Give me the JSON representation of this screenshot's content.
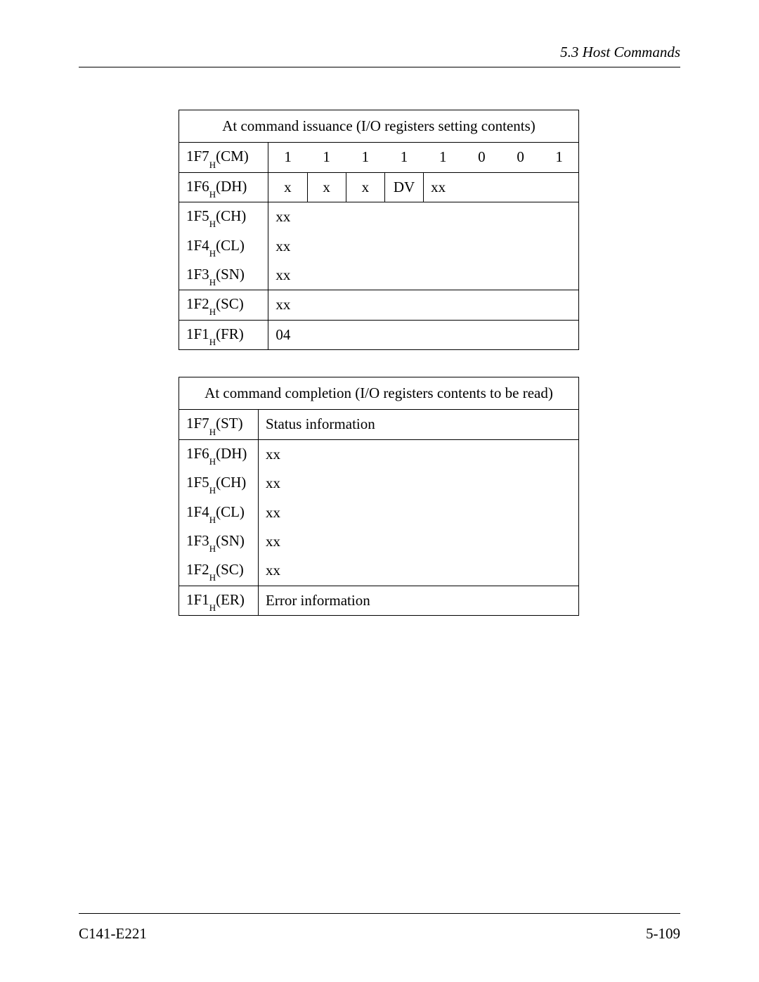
{
  "header": {
    "section": "5.3  Host Commands"
  },
  "table1": {
    "title": "At command issuance (I/O registers setting contents)",
    "rows": [
      {
        "reg": {
          "addr": "1F7",
          "sub": "H",
          "name": "(CM)"
        },
        "bits": [
          "1",
          "1",
          "1",
          "1",
          "1",
          "0",
          "0",
          "1"
        ],
        "bit_borders": [
          false,
          false,
          false,
          false,
          false,
          false,
          false,
          false
        ],
        "type": "bits"
      },
      {
        "reg": {
          "addr": "1F6",
          "sub": "H",
          "name": "(DH)"
        },
        "bits": [
          "x",
          "x",
          "x",
          "DV",
          "xx"
        ],
        "bit_borders": [
          true,
          true,
          true,
          true,
          false
        ],
        "wide_last": true,
        "type": "bits-dh",
        "row_border_top": true
      },
      {
        "reg": {
          "addr": "1F5",
          "sub": "H",
          "name": "(CH)"
        },
        "value": "xx",
        "type": "group-first"
      },
      {
        "reg": {
          "addr": "1F4",
          "sub": "H",
          "name": "(CL)"
        },
        "value": "xx",
        "type": "group"
      },
      {
        "reg": {
          "addr": "1F3",
          "sub": "H",
          "name": "(SN)"
        },
        "value": "xx",
        "type": "group"
      },
      {
        "reg": {
          "addr": "1F2",
          "sub": "H",
          "name": "(SC)"
        },
        "value": "xx",
        "type": "single"
      },
      {
        "reg": {
          "addr": "1F1",
          "sub": "H",
          "name": "(FR)"
        },
        "value": "04",
        "type": "single"
      }
    ]
  },
  "table2": {
    "title": "At command completion (I/O registers contents to be read)",
    "rows": [
      {
        "reg": {
          "addr": "1F7",
          "sub": "H",
          "name": "(ST)"
        },
        "value": "Status information",
        "type": "single-first"
      },
      {
        "reg": {
          "addr": "1F6",
          "sub": "H",
          "name": "(DH)"
        },
        "value": "xx",
        "type": "group-first"
      },
      {
        "reg": {
          "addr": "1F5",
          "sub": "H",
          "name": "(CH)"
        },
        "value": "xx",
        "type": "group"
      },
      {
        "reg": {
          "addr": "1F4",
          "sub": "H",
          "name": "(CL)"
        },
        "value": "xx",
        "type": "group"
      },
      {
        "reg": {
          "addr": "1F3",
          "sub": "H",
          "name": "(SN)"
        },
        "value": "xx",
        "type": "group"
      },
      {
        "reg": {
          "addr": "1F2",
          "sub": "H",
          "name": "(SC)"
        },
        "value": "xx",
        "type": "group"
      },
      {
        "reg": {
          "addr": "1F1",
          "sub": "H",
          "name": "(ER)"
        },
        "value": "Error information",
        "type": "single"
      }
    ]
  },
  "footer": {
    "left": "C141-E221",
    "right": "5-109"
  }
}
